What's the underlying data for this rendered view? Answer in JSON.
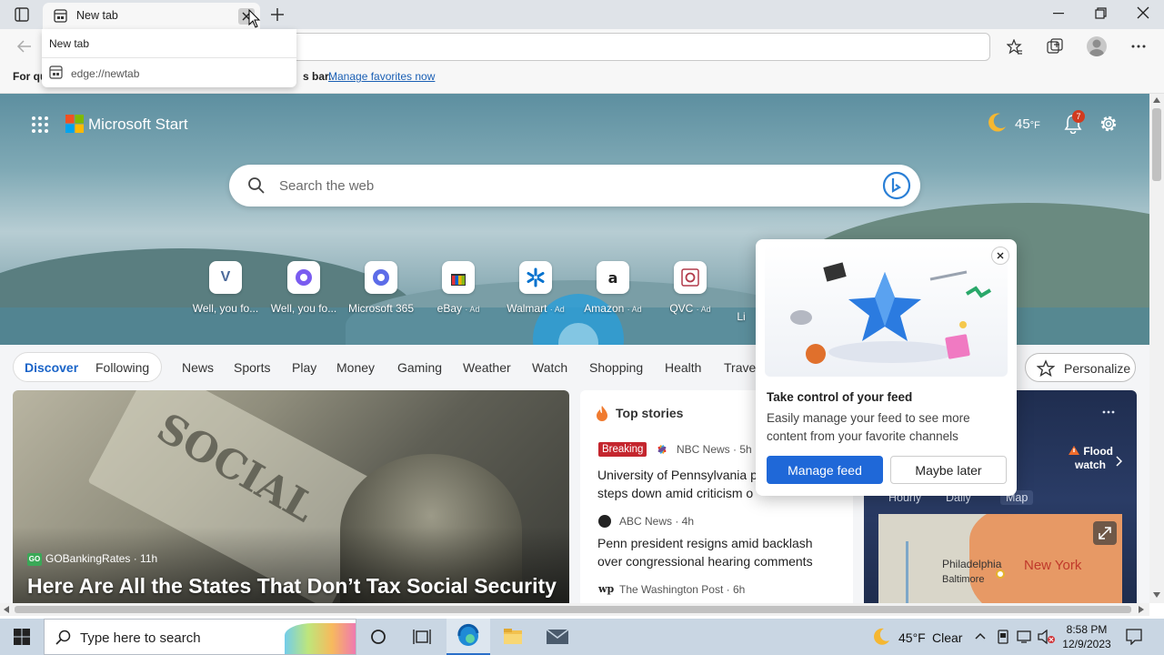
{
  "browser": {
    "tab_title": "New tab",
    "hover_popup": {
      "title": "New tab",
      "url": "edge://newtab"
    },
    "favorites_bar": {
      "text_start": "For qu",
      "text_end": "s bar.",
      "link": "Manage favorites now"
    }
  },
  "header": {
    "brand": "Microsoft Start",
    "weather_temp": "45",
    "weather_unit": "°F",
    "notification_count": "7"
  },
  "search": {
    "placeholder": "Search the web"
  },
  "quick_links": [
    {
      "label": "Well, you fo...",
      "ad": "",
      "icon": "V"
    },
    {
      "label": "Well, you fo...",
      "ad": "",
      "icon": "copilot"
    },
    {
      "label": "Microsoft 365",
      "ad": "",
      "icon": "copilot"
    },
    {
      "label": "eBay",
      "ad": "· Ad",
      "icon": "bag"
    },
    {
      "label": "Walmart",
      "ad": "· Ad",
      "icon": "spark"
    },
    {
      "label": "Amazon",
      "ad": "· Ad",
      "icon": "a"
    },
    {
      "label": "QVC",
      "ad": "· Ad",
      "icon": "Q"
    },
    {
      "label": "Li",
      "ad": "",
      "icon": ""
    }
  ],
  "nav": {
    "tabs": [
      "Discover",
      "Following"
    ],
    "items": [
      "News",
      "Sports",
      "Play",
      "Money",
      "Gaming",
      "Weather",
      "Watch",
      "Shopping",
      "Health",
      "Travel"
    ],
    "personalize": "Personalize"
  },
  "big_card": {
    "source": "GOBankingRates · 11h",
    "source_logo": "GO",
    "headline": "Here Are All the States That Don’t Tax Social Security",
    "image_text": "SOCIAL"
  },
  "top_stories": {
    "title": "Top stories",
    "stories": [
      {
        "badge": "Breaking",
        "source": "NBC News · 5h",
        "line1": "University of Pennsylvania p",
        "line2": "steps down amid criticism o"
      },
      {
        "badge": "",
        "source": "ABC News · 4h",
        "line1": "Penn president resigns amid backlash",
        "line2": "over congressional hearing comments"
      },
      {
        "badge": "",
        "source": "The Washington Post · 6h",
        "line1": "",
        "line2": ""
      }
    ]
  },
  "weather_card": {
    "alert": "Flood watch",
    "alert_line1": "Flood",
    "alert_line2": "watch",
    "tabs": [
      "Hourly",
      "Daily",
      "Map"
    ],
    "map_labels": [
      "Philadelphia",
      "Baltimore",
      "New York"
    ]
  },
  "feed_popup": {
    "title": "Take control of your feed",
    "description": "Easily manage your feed to see more content from your favorite channels",
    "primary": "Manage feed",
    "secondary": "Maybe later"
  },
  "taskbar": {
    "search_placeholder": "Type here to search",
    "weather": "45°F",
    "condition": "Clear",
    "time": "8:58 PM",
    "date": "12/9/2023"
  }
}
